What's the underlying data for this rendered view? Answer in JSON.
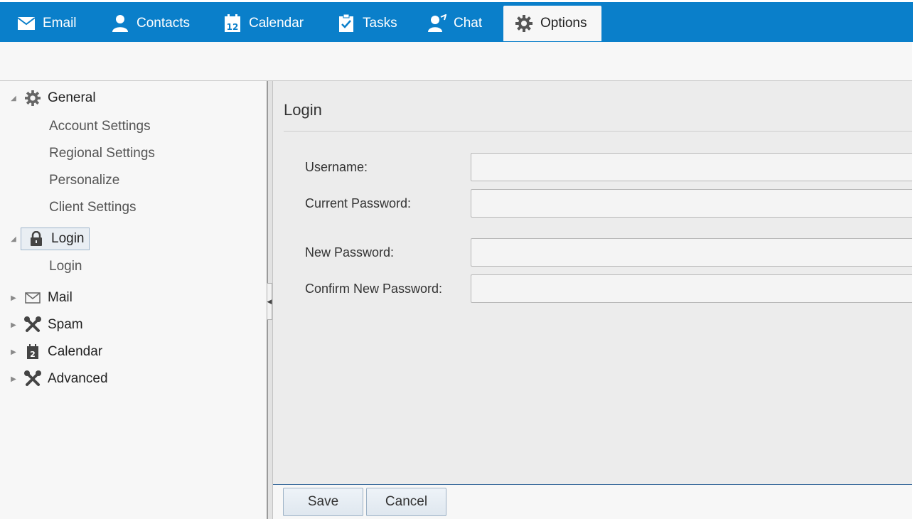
{
  "tabs": [
    {
      "label": "Email",
      "icon": "envelope-icon"
    },
    {
      "label": "Contacts",
      "icon": "person-icon"
    },
    {
      "label": "Calendar",
      "icon": "calendar-icon",
      "icon_text": "12"
    },
    {
      "label": "Tasks",
      "icon": "clipboard-check-icon"
    },
    {
      "label": "Chat",
      "icon": "chat-person-icon"
    },
    {
      "label": "Options",
      "icon": "gear-icon",
      "active": true
    }
  ],
  "tree": {
    "general": {
      "label": "General",
      "icon": "gear-icon",
      "expanded": true,
      "children": [
        "Account Settings",
        "Regional Settings",
        "Personalize",
        "Client Settings"
      ]
    },
    "login": {
      "label": "Login",
      "icon": "lock-icon",
      "expanded": true,
      "selected": true,
      "children": [
        "Login"
      ]
    },
    "mail": {
      "label": "Mail",
      "icon": "envelope-icon",
      "expanded": false
    },
    "spam": {
      "label": "Spam",
      "icon": "tools-icon",
      "expanded": false
    },
    "calendar": {
      "label": "Calendar",
      "icon": "calendar-icon",
      "icon_text": "2",
      "expanded": false
    },
    "advanced": {
      "label": "Advanced",
      "icon": "tools-icon",
      "expanded": false
    }
  },
  "main": {
    "title": "Login",
    "fields": {
      "username": {
        "label": "Username:",
        "value": ""
      },
      "current_password": {
        "label": "Current Password:",
        "value": ""
      },
      "new_password": {
        "label": "New Password:",
        "value": ""
      },
      "confirm_password": {
        "label": "Confirm New Password:",
        "value": ""
      }
    }
  },
  "footer": {
    "save_label": "Save",
    "cancel_label": "Cancel"
  },
  "colors": {
    "accent": "#0a7fca",
    "selection_border": "#9fb6cc",
    "panel": "#ececec"
  }
}
